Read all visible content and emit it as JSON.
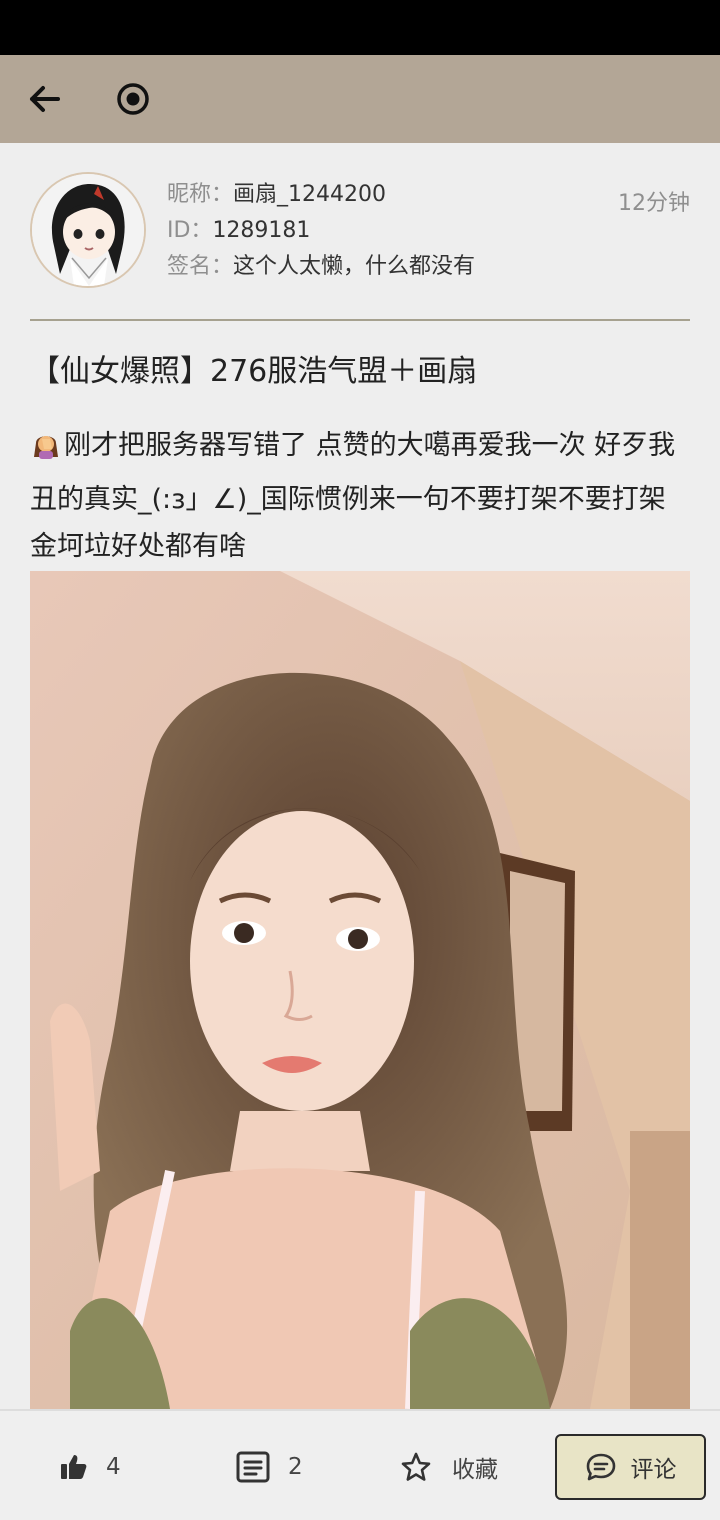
{
  "toolbar": {
    "back_icon": "arrow-left-icon",
    "target_icon": "target-icon"
  },
  "author": {
    "nickname_label": "昵称：",
    "nickname": "画扇_1244200",
    "id_label": "ID：",
    "id": "1289181",
    "signature_label": "签名：",
    "signature": "这个人太懒，什么都没有",
    "time": "12分钟"
  },
  "post": {
    "title": "【仙女爆照】276服浩气盟＋画扇",
    "body": "刚才把服务器写错了 点赞的大噶再爱我一次 好歹我丑的真实_(:з」∠)_国际惯例来一句不要打架不要打架 金坷垃好处都有啥"
  },
  "actions": {
    "like_count": "4",
    "comment_count": "2",
    "favorite_label": "收藏",
    "comment_label": "评论"
  },
  "colors": {
    "toolbar": "#b3a696",
    "accent_button": "#e8e4c6",
    "divider": "#a6a18f"
  }
}
